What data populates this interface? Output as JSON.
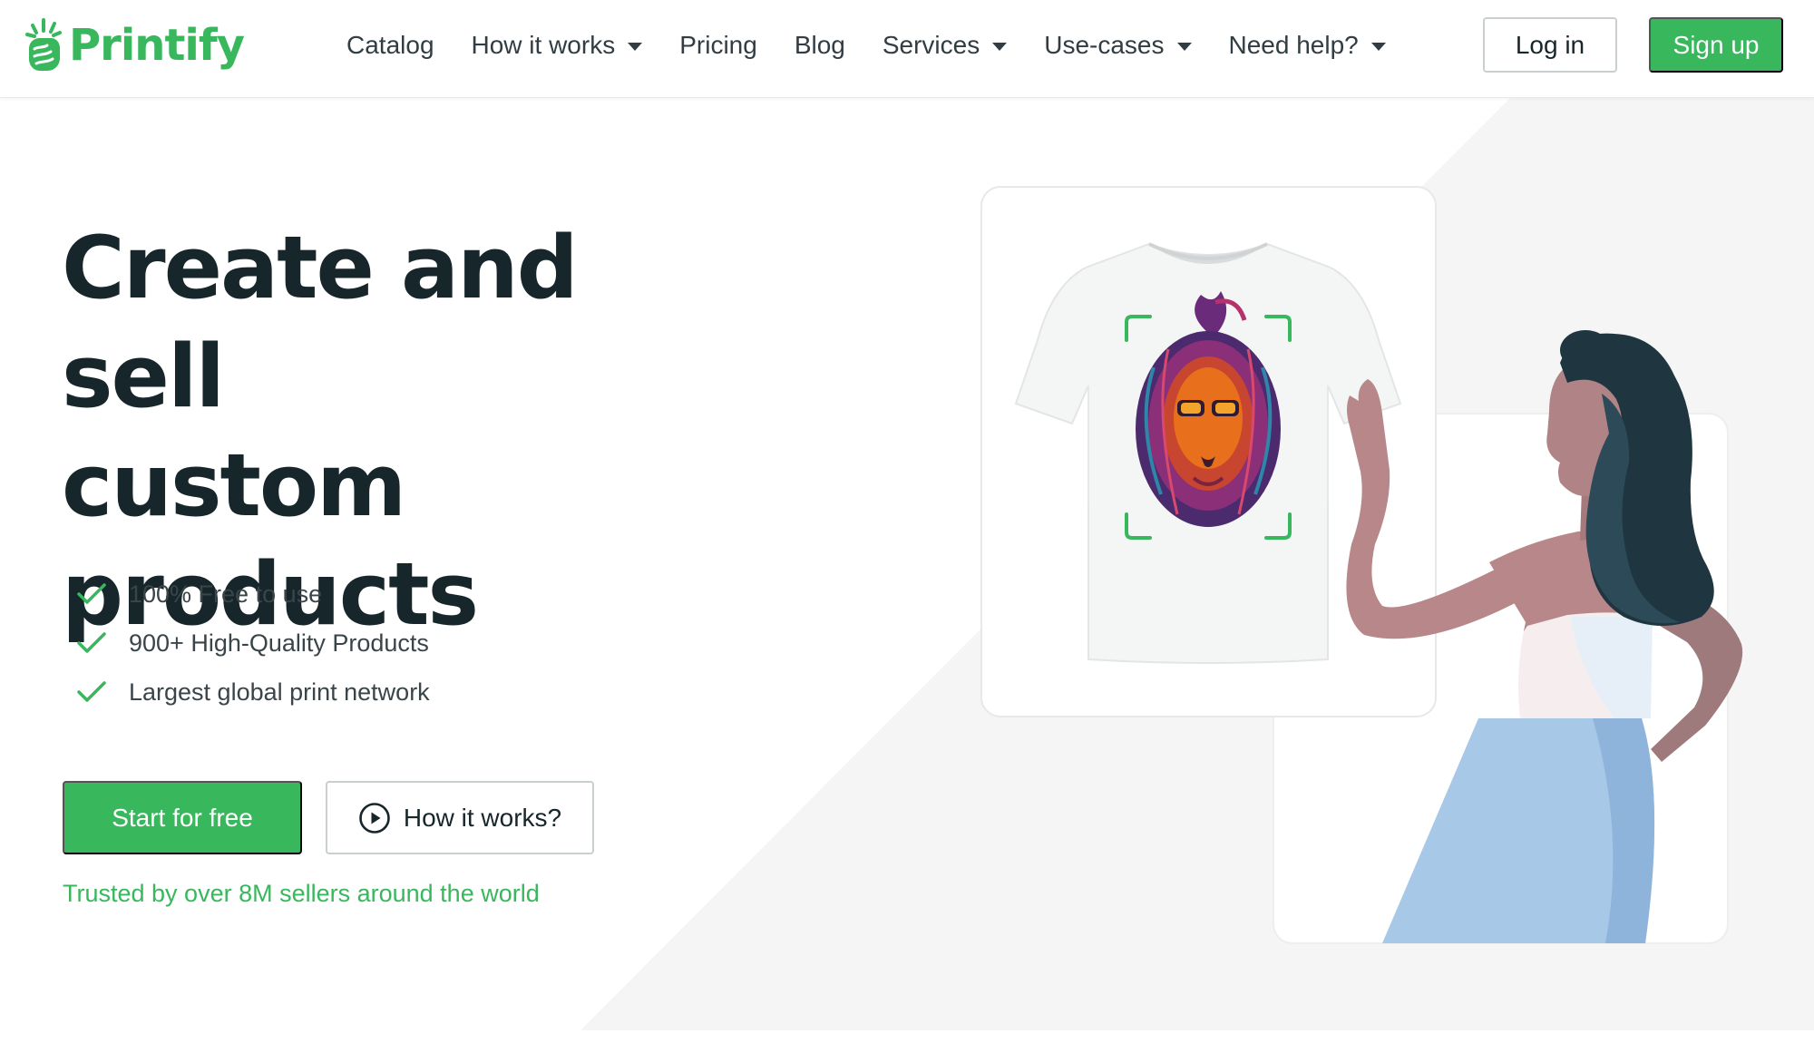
{
  "brand": {
    "name": "Printify",
    "logo_icon": "printify-hand-logo-icon",
    "accent_color": "#39b75d",
    "text_color": "#17262b"
  },
  "nav": {
    "items": [
      {
        "label": "Catalog",
        "has_dropdown": false
      },
      {
        "label": "How it works",
        "has_dropdown": true
      },
      {
        "label": "Pricing",
        "has_dropdown": false
      },
      {
        "label": "Blog",
        "has_dropdown": false
      },
      {
        "label": "Services",
        "has_dropdown": true
      },
      {
        "label": "Use-cases",
        "has_dropdown": true
      },
      {
        "label": "Need help?",
        "has_dropdown": true
      }
    ],
    "login_label": "Log in",
    "signup_label": "Sign up"
  },
  "hero": {
    "title_lines": [
      "Create and sell",
      "custom",
      "products"
    ],
    "features": [
      "100% Free to use",
      "900+ High-Quality Products",
      "Largest global print network"
    ],
    "feature_icon": "check-icon",
    "primary_cta": "Start for free",
    "secondary_cta": "How it works?",
    "secondary_cta_icon": "play-circle-icon",
    "trusted_text": "Trusted by over 8M sellers around the world"
  },
  "illustration": {
    "product": "t-shirt-with-lion-print",
    "person": "woman-pointing"
  }
}
